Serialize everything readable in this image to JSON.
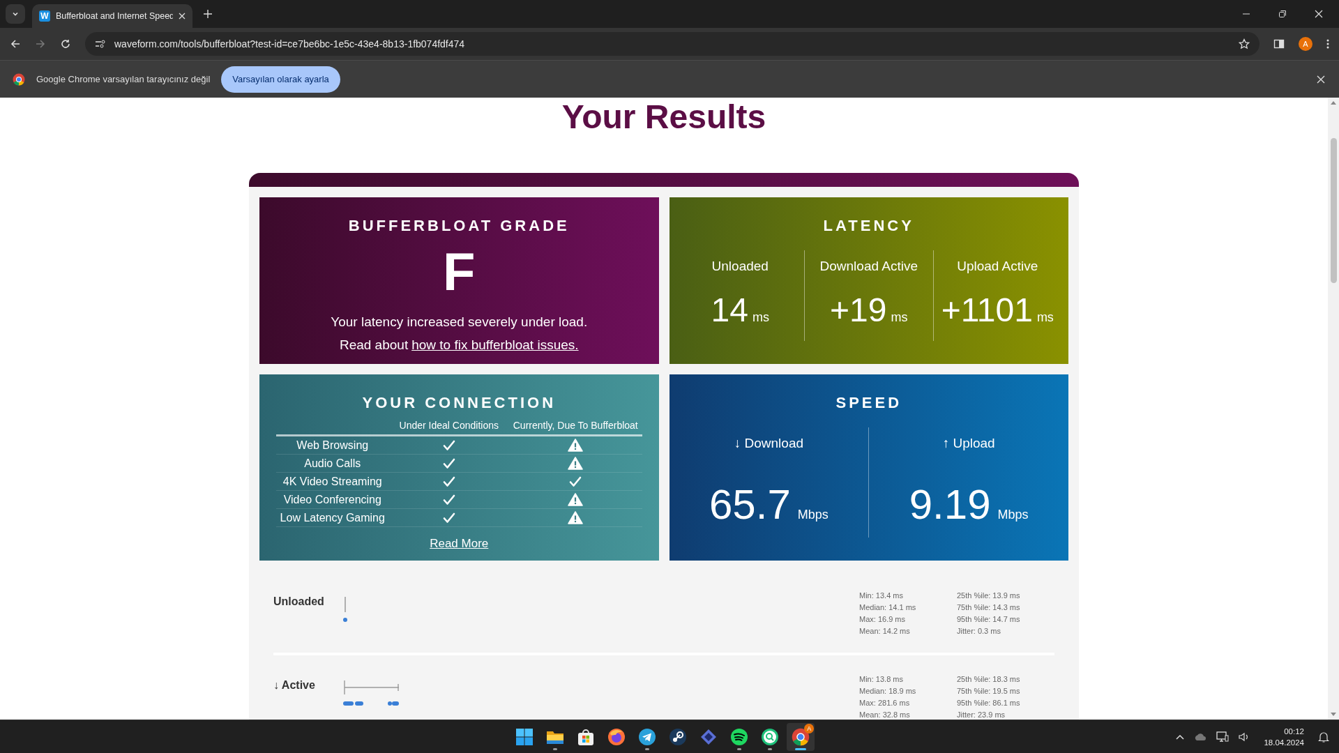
{
  "browser": {
    "tabs": [
      {
        "favicon_letter": "W",
        "title": "Bufferbloat and Internet Speed",
        "selected": true
      }
    ],
    "url": "waveform.com/tools/bufferbloat?test-id=ce7be6bc-1e5c-43e4-8b13-1fb074fdf474",
    "profile_initial": "A",
    "infobar": {
      "message": "Google Chrome varsayılan tarayıcınız değil",
      "button": "Varsayılan olarak ayarla"
    }
  },
  "page": {
    "title": "Your Results",
    "grade": {
      "title": "BUFFERBLOAT GRADE",
      "grade": "F",
      "message": "Your latency increased severely under load.",
      "link_prefix": "Read about",
      "link": "how to fix bufferbloat issues."
    },
    "latency": {
      "title": "LATENCY",
      "columns": [
        {
          "label": "Unloaded",
          "value": "14",
          "unit": "ms"
        },
        {
          "label": "Download Active",
          "value": "+19",
          "unit": "ms"
        },
        {
          "label": "Upload Active",
          "value": "+1101",
          "unit": "ms"
        }
      ]
    },
    "connection": {
      "title": "YOUR CONNECTION",
      "headers": [
        "Under Ideal Conditions",
        "Currently, Due To Bufferbloat"
      ],
      "rows": [
        {
          "name": "Web Browsing",
          "ideal_ok": true,
          "current_ok": false
        },
        {
          "name": "Audio Calls",
          "ideal_ok": true,
          "current_ok": false
        },
        {
          "name": "4K Video Streaming",
          "ideal_ok": true,
          "current_ok": true
        },
        {
          "name": "Video Conferencing",
          "ideal_ok": true,
          "current_ok": false
        },
        {
          "name": "Low Latency Gaming",
          "ideal_ok": true,
          "current_ok": false
        }
      ],
      "read_more": "Read More"
    },
    "speed": {
      "title": "SPEED",
      "columns": [
        {
          "label": "↓ Download",
          "value": "65.7",
          "unit": "Mbps"
        },
        {
          "label": "↑ Upload",
          "value": "9.19",
          "unit": "Mbps"
        }
      ]
    },
    "measurements": [
      {
        "label": "Unloaded",
        "kind": "unloaded",
        "stats": [
          "Min: 13.4 ms",
          "Median: 14.1 ms",
          "Max: 16.9 ms",
          "Mean: 14.2 ms",
          "25th %ile: 13.9 ms",
          "75th %ile: 14.3 ms",
          "95th %ile: 14.7 ms",
          "Jitter: 0.3 ms"
        ]
      },
      {
        "label": "↓ Active",
        "kind": "active",
        "stats": [
          "Min: 13.8 ms",
          "Median: 18.9 ms",
          "Max: 281.6 ms",
          "Mean: 32.8 ms",
          "25th %ile: 18.3 ms",
          "75th %ile: 19.5 ms",
          "95th %ile: 86.1 ms",
          "Jitter: 23.9 ms"
        ]
      }
    ]
  },
  "taskbar": {
    "apps": [
      {
        "kind": "start",
        "running": false,
        "selected": false
      },
      {
        "kind": "folder",
        "running": true,
        "selected": false
      },
      {
        "kind": "store",
        "running": false,
        "selected": false
      },
      {
        "kind": "firefox",
        "running": false,
        "selected": false
      },
      {
        "kind": "telegram",
        "running": true,
        "selected": false
      },
      {
        "kind": "steam",
        "running": false,
        "selected": false
      },
      {
        "kind": "kodi",
        "running": false,
        "selected": false
      },
      {
        "kind": "spotify",
        "running": true,
        "selected": false
      },
      {
        "kind": "search",
        "running": true,
        "selected": false
      },
      {
        "kind": "chrome",
        "running": true,
        "selected": true,
        "badge": "A"
      }
    ],
    "time": "00:12",
    "date": "18.04.2024"
  }
}
